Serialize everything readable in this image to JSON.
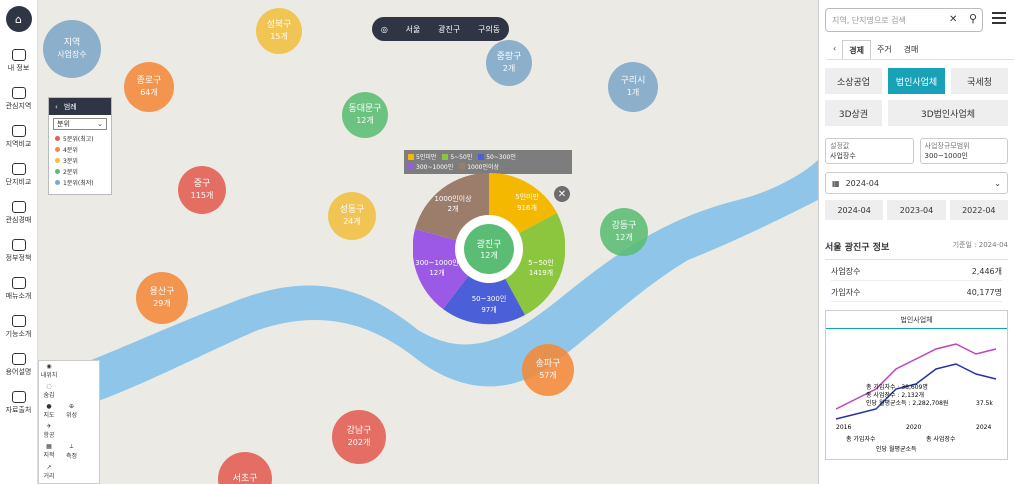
{
  "sidebar": {
    "logo": "⌂",
    "items": [
      {
        "label": "내 정보"
      },
      {
        "label": "관심지역"
      },
      {
        "label": "지역비교"
      },
      {
        "label": "단지비교"
      },
      {
        "label": "관심경매"
      },
      {
        "label": "정부정책"
      },
      {
        "label": "매뉴소개"
      },
      {
        "label": "기능소개"
      },
      {
        "label": "용어설명"
      },
      {
        "label": "자료출처"
      }
    ]
  },
  "legend": {
    "title": "범례",
    "select": "분위",
    "rows": [
      {
        "label": "5분위(최고)",
        "color": "#e55d53"
      },
      {
        "label": "4분위",
        "color": "#f58a3b"
      },
      {
        "label": "3분위",
        "color": "#f2c040"
      },
      {
        "label": "2분위",
        "color": "#5bbd74"
      },
      {
        "label": "1분위(최저)",
        "color": "#7fa7c9"
      }
    ]
  },
  "region_badge": {
    "name": "지역",
    "sub": "사업장수"
  },
  "breadcrumb": {
    "city": "서울",
    "district": "광진구",
    "dong": "구의동"
  },
  "bubbles": [
    {
      "name": "성북구",
      "count": "15개",
      "color": "#f2c040"
    },
    {
      "name": "종로구",
      "count": "64개",
      "color": "#f58a3b"
    },
    {
      "name": "동대문구",
      "count": "12개",
      "color": "#5bbd74"
    },
    {
      "name": "중랑구",
      "count": "2개",
      "color": "#7fa7c9"
    },
    {
      "name": "구리시",
      "count": "1개",
      "color": "#7fa7c9"
    },
    {
      "name": "중구",
      "count": "115개",
      "color": "#e55d53"
    },
    {
      "name": "성동구",
      "count": "24개",
      "color": "#f2c040"
    },
    {
      "name": "강동구",
      "count": "12개",
      "color": "#5bbd74"
    },
    {
      "name": "용산구",
      "count": "29개",
      "color": "#f58a3b"
    },
    {
      "name": "송파구",
      "count": "57개",
      "color": "#f58a3b"
    },
    {
      "name": "강남구",
      "count": "202개",
      "color": "#e55d53"
    },
    {
      "name": "서초구",
      "count": "",
      "color": "#e55d53"
    }
  ],
  "pie": {
    "center_name": "광진구",
    "center_count": "12개",
    "legend": [
      {
        "label": "5인미만",
        "color": "#f5b800"
      },
      {
        "label": "5~50인",
        "color": "#8cc63f"
      },
      {
        "label": "50~300인",
        "color": "#4a5fd8"
      },
      {
        "label": "300~1000인",
        "color": "#9b59e6"
      },
      {
        "label": "1000인이상",
        "color": "#9c7c6a"
      }
    ],
    "slices": [
      {
        "label": "5인미만",
        "count": "916개",
        "value": 916,
        "color": "#f5b800"
      },
      {
        "label": "5~50인",
        "count": "1419개",
        "value": 1419,
        "color": "#8cc63f"
      },
      {
        "label": "50~300인",
        "count": "97개",
        "value": 97,
        "color": "#4a5fd8"
      },
      {
        "label": "300~1000인",
        "count": "12개",
        "value": 12,
        "color": "#9b59e6"
      },
      {
        "label": "1000인이상",
        "count": "2개",
        "value": 2,
        "color": "#9c7c6a"
      }
    ]
  },
  "tools": [
    "내위치",
    "숨김",
    "지도",
    "위성",
    "항공",
    "지적",
    "측정",
    "거리",
    "공유"
  ],
  "panel": {
    "search_placeholder": "지역, 단지명으로 검색",
    "tabs": [
      "경제",
      "주거",
      "경매"
    ],
    "active_tab": "경제",
    "categories": [
      "소상공업",
      "법인사업체",
      "국세청",
      "3D상권",
      "3D법인사업체"
    ],
    "active_category": "법인사업체",
    "field1_label": "설정값",
    "field1_value": "사업장수",
    "field2_label": "사업장규모범위",
    "field2_value": "300~1000인",
    "month": "2024-04",
    "months": [
      "2024-04",
      "2023-04",
      "2022-04"
    ],
    "info_title": "서울 광진구 정보",
    "info_date": "기준일 : 2024-04",
    "rows": [
      {
        "label": "사업장수",
        "value": "2,446",
        "unit": "개"
      },
      {
        "label": "가입자수",
        "value": "40,177",
        "unit": "명"
      }
    ],
    "chart_tab": "법인사업체",
    "chart_labels": {
      "y": "37.5k",
      "x": [
        "2016",
        "2020",
        "2024"
      ],
      "tooltip": [
        "총 가입자수 : 38,609명",
        "총 사업장수 : 2,132개",
        "인당 월평균소득 : 2,282,708원"
      ],
      "legend": [
        "총 가입자수",
        "총 사업장수",
        "인당 월평균소득"
      ]
    }
  }
}
